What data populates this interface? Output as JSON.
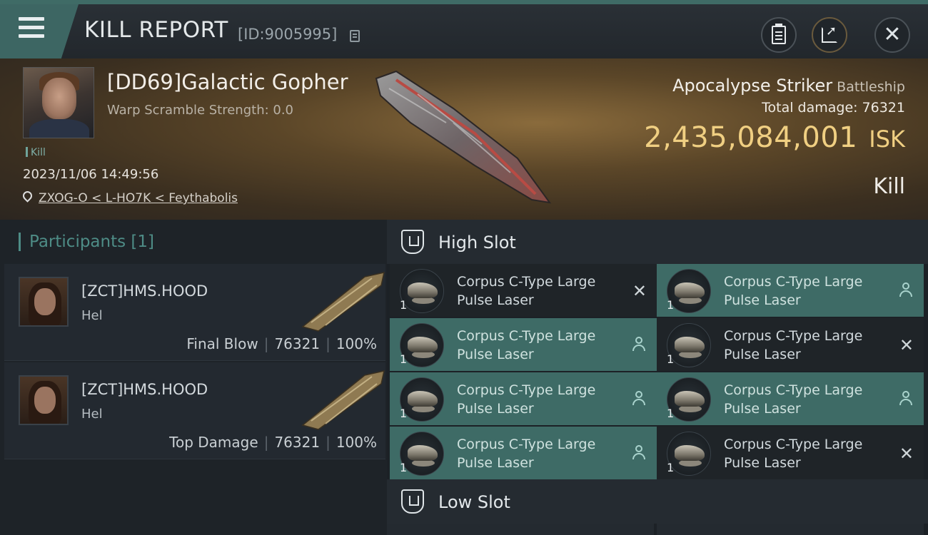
{
  "header": {
    "title": "KILL REPORT",
    "report_id": "[ID:9005995]"
  },
  "victim": {
    "name": "[DD69]Galactic Gopher",
    "warp_scramble": "Warp Scramble Strength: 0.0",
    "tag": "Kill",
    "datetime": "2023/11/06 14:49:56",
    "location": "ZXOG-O < L-HO7K < Feythabolis",
    "ship_name": "Apocalypse Striker",
    "ship_class": "Battleship",
    "total_damage_label": "Total damage:",
    "total_damage_value": "76321",
    "isk_value": "2,435,084,001",
    "isk_unit": "ISK",
    "kill_label": "Kill"
  },
  "participants": {
    "title": "Participants",
    "count": "[1]",
    "rows": [
      {
        "name": "[ZCT]HMS.HOOD",
        "sub": "Hel",
        "role": "Final Blow",
        "damage": "76321",
        "percent": "100%"
      },
      {
        "name": "[ZCT]HMS.HOOD",
        "sub": "Hel",
        "role": "Top Damage",
        "damage": "76321",
        "percent": "100%"
      }
    ]
  },
  "slots": {
    "high_label": "High Slot",
    "low_label": "Low Slot",
    "high_modules": [
      {
        "line1": "Corpus C-Type Large",
        "line2": "Pulse Laser",
        "qty": "1",
        "status": "destroyed"
      },
      {
        "line1": "Corpus C-Type Large",
        "line2": "Pulse Laser",
        "qty": "1",
        "status": "dropped"
      },
      {
        "line1": "Corpus C-Type Large",
        "line2": "Pulse Laser",
        "qty": "1",
        "status": "dropped"
      },
      {
        "line1": "Corpus C-Type Large",
        "line2": "Pulse Laser",
        "qty": "1",
        "status": "destroyed"
      },
      {
        "line1": "Corpus C-Type Large",
        "line2": "Pulse Laser",
        "qty": "1",
        "status": "dropped"
      },
      {
        "line1": "Corpus C-Type Large",
        "line2": "Pulse Laser",
        "qty": "1",
        "status": "dropped"
      },
      {
        "line1": "Corpus C-Type Large",
        "line2": "Pulse Laser",
        "qty": "1",
        "status": "dropped"
      },
      {
        "line1": "Corpus C-Type Large",
        "line2": "Pulse Laser",
        "qty": "1",
        "status": "destroyed"
      }
    ],
    "destroyed_glyph": "✕"
  },
  "icons": {
    "menu": "menu-icon",
    "copy": "copy-icon",
    "clipboard": "clipboard-icon",
    "share": "share-icon",
    "close": "close-icon",
    "location": "location-pin-icon",
    "slot": "slot-shield-icon",
    "dropped": "person-icon"
  },
  "colors": {
    "accent": "#3e6b66",
    "isk": "#f0cf82",
    "participants_title": "#4e8c86"
  }
}
